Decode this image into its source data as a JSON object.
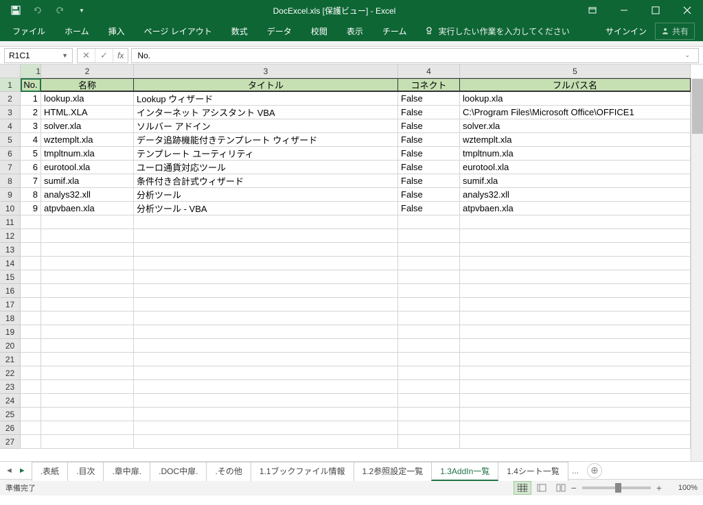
{
  "title": "DocExcel.xls  [保護ビュー] - Excel",
  "ribbon": {
    "file": "ファイル",
    "home": "ホーム",
    "insert": "挿入",
    "layout": "ページ レイアウト",
    "formulas": "数式",
    "data": "データ",
    "review": "校閲",
    "view": "表示",
    "team": "チーム",
    "tellme": "実行したい作業を入力してください",
    "signin": "サインイン",
    "share": "共有"
  },
  "namebox": "R1C1",
  "formula": "No.",
  "cols": [
    "1",
    "2",
    "3",
    "4",
    "5"
  ],
  "rows": [
    "1",
    "2",
    "3",
    "4",
    "5",
    "6",
    "7",
    "8",
    "9",
    "10",
    "11",
    "12",
    "13",
    "14",
    "15",
    "16",
    "17",
    "18",
    "19",
    "20",
    "21",
    "22",
    "23",
    "24",
    "25",
    "26",
    "27"
  ],
  "headers": {
    "no": "No.",
    "name": "名称",
    "title_h": "タイトル",
    "connect": "コネクト",
    "fullpath": "フルパス名"
  },
  "data": [
    {
      "no": "1",
      "name": "lookup.xla",
      "title": "Lookup ウィザード",
      "connect": "False",
      "path": "lookup.xla"
    },
    {
      "no": "2",
      "name": "HTML.XLA",
      "title": "インターネット アシスタント VBA",
      "connect": "False",
      "path": "C:\\Program Files\\Microsoft Office\\OFFICE1"
    },
    {
      "no": "3",
      "name": "solver.xla",
      "title": "ソルバー アドイン",
      "connect": "False",
      "path": "solver.xla"
    },
    {
      "no": "4",
      "name": "wztemplt.xla",
      "title": "データ追跡機能付きテンプレート ウィザード",
      "connect": "False",
      "path": "wztemplt.xla"
    },
    {
      "no": "5",
      "name": "tmpltnum.xla",
      "title": "テンプレート ユーティリティ",
      "connect": "False",
      "path": "tmpltnum.xla"
    },
    {
      "no": "6",
      "name": "eurotool.xla",
      "title": "ユーロ通貨対応ツール",
      "connect": "False",
      "path": "eurotool.xla"
    },
    {
      "no": "7",
      "name": "sumif.xla",
      "title": "条件付き合計式ウィザード",
      "connect": "False",
      "path": "sumif.xla"
    },
    {
      "no": "8",
      "name": "analys32.xll",
      "title": "分析ツール",
      "connect": "False",
      "path": "analys32.xll"
    },
    {
      "no": "9",
      "name": "atpvbaen.xla",
      "title": "分析ツール - VBA",
      "connect": "False",
      "path": "atpvbaen.xla"
    }
  ],
  "sheets": [
    ".表紙",
    ".目次",
    ".章中扉.",
    ".DOC中扉.",
    ".その他",
    "1.1ブックファイル情報",
    "1.2参照設定一覧",
    "1.3AddIn一覧",
    "1.4シート一覧"
  ],
  "active_sheet": "1.3AddIn一覧",
  "status": "準備完了",
  "zoom": "100%"
}
